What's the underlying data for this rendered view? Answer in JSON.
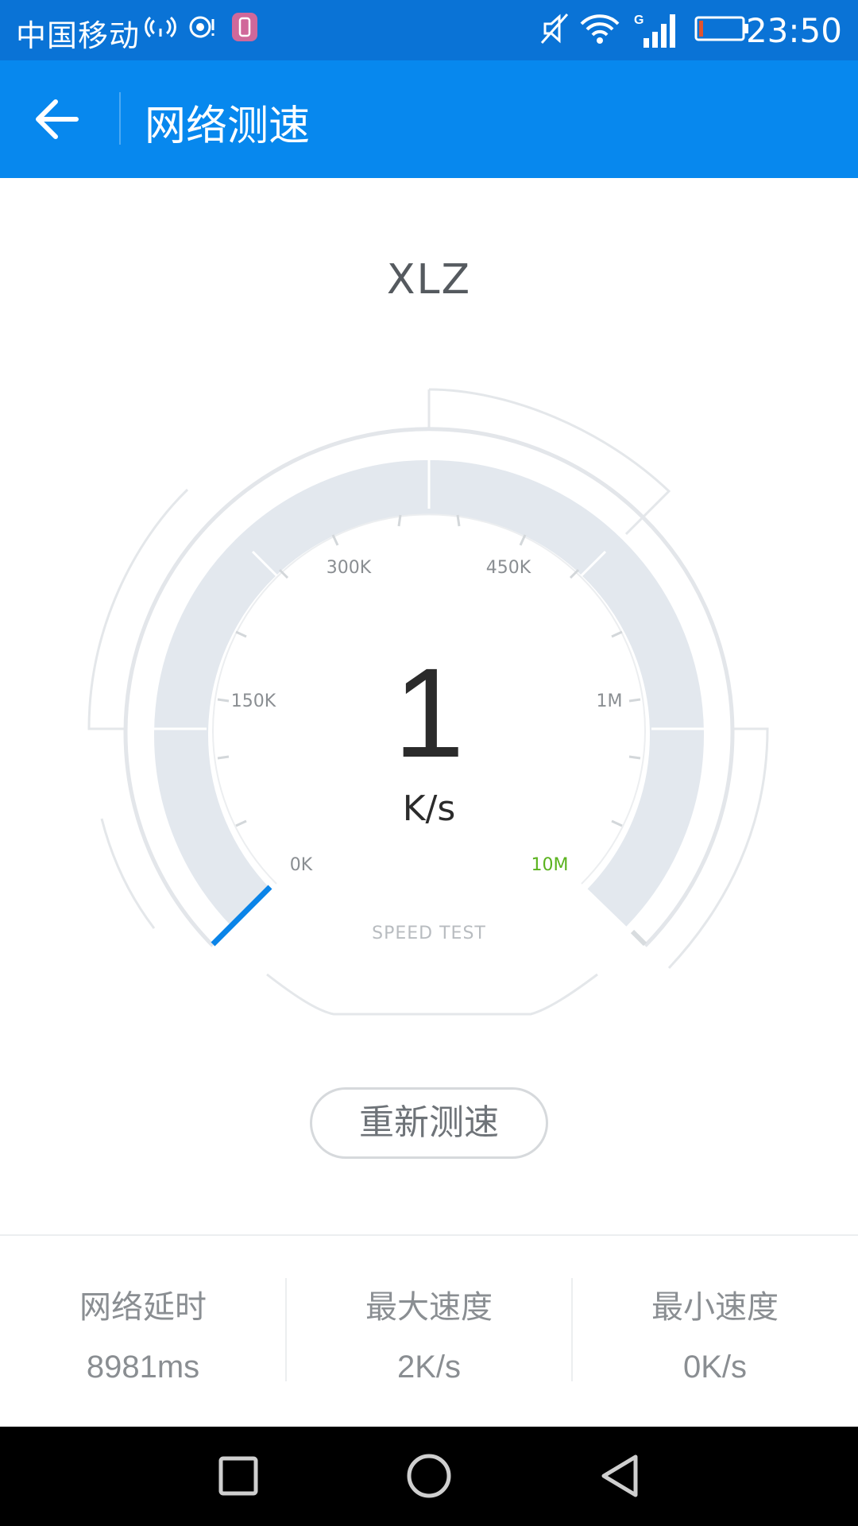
{
  "status_bar": {
    "carrier": "中国移动",
    "time": "23:50"
  },
  "app_bar": {
    "title": "网络测速"
  },
  "network": {
    "ssid": "XLZ"
  },
  "gauge": {
    "speed_value": "1",
    "speed_unit": "K/s",
    "caption": "SPEED TEST",
    "ticks": [
      "0K",
      "150K",
      "300K",
      "450K",
      "1M",
      "10M"
    ]
  },
  "actions": {
    "retest_label": "重新测速"
  },
  "stats": [
    {
      "label": "网络延时",
      "value": "8981ms"
    },
    {
      "label": "最大速度",
      "value": "2K/s"
    },
    {
      "label": "最小速度",
      "value": "0K/s"
    }
  ],
  "colors": {
    "accent": "#0788ee",
    "highlight_tick": "#5ab31e",
    "track": "#e3e8ee"
  }
}
